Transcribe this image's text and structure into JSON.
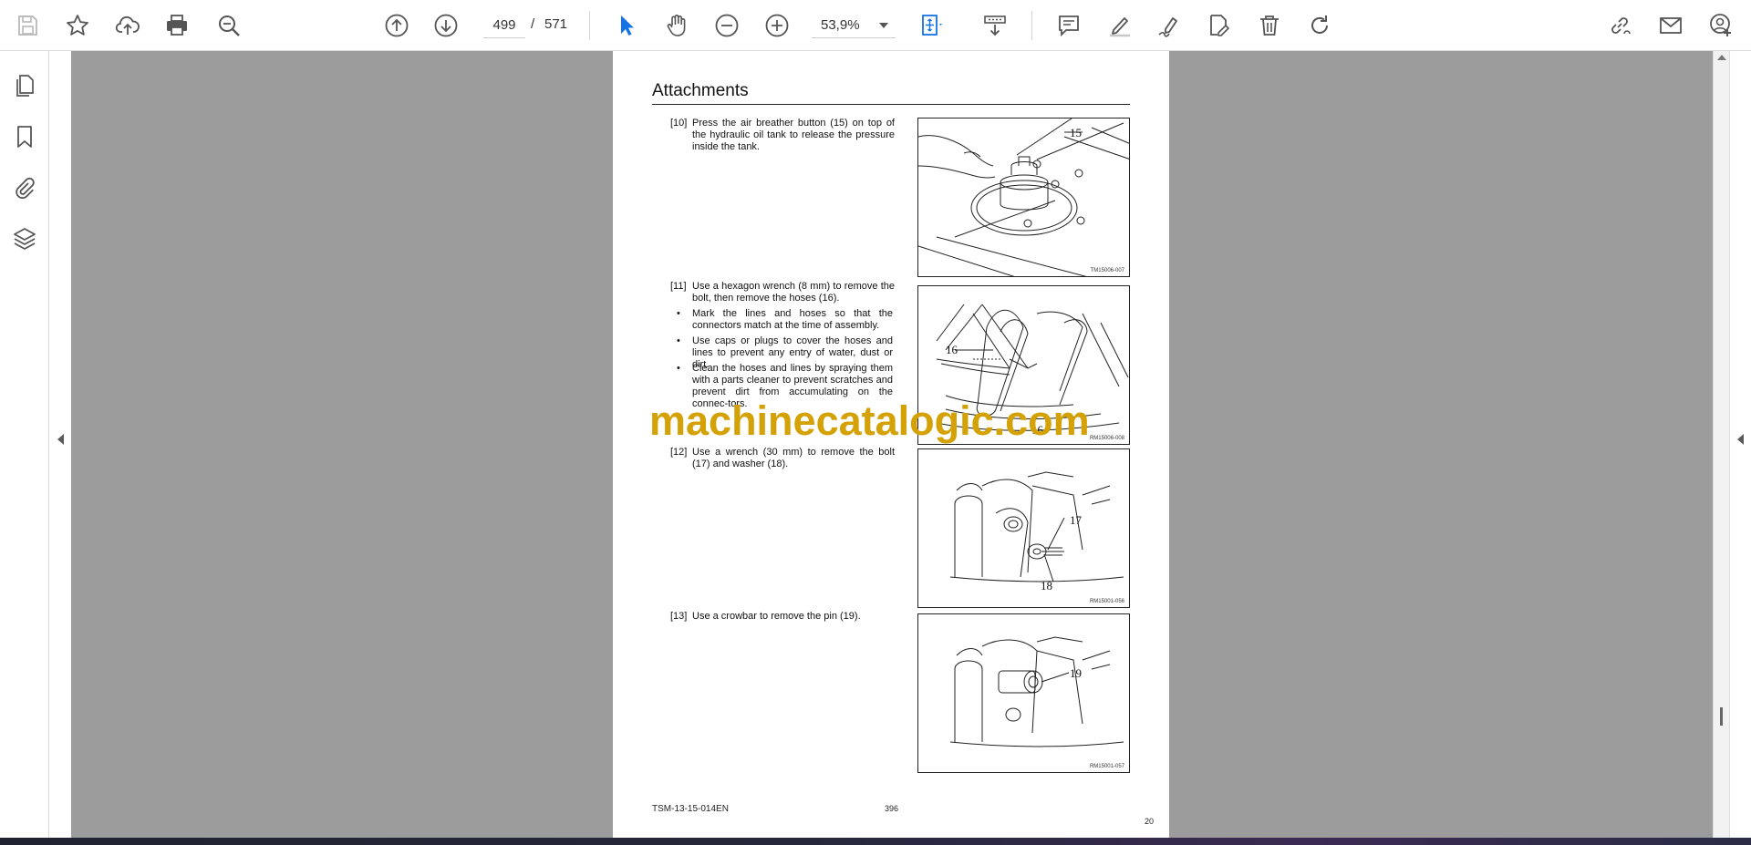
{
  "toolbar": {
    "page_current": "499",
    "page_separator": "/",
    "page_total": "571",
    "zoom": "53,9%",
    "accent_color": "#1473e6",
    "icons": [
      "save-icon",
      "bookmark-star-icon",
      "cloud-upload-icon",
      "print-icon",
      "zoom-search-icon",
      "page-up-icon",
      "page-down-icon",
      "select-cursor-icon",
      "hand-tool-icon",
      "zoom-out-icon",
      "zoom-in-icon",
      "fit-page-icon",
      "scroll-mode-icon",
      "comment-icon",
      "highlight-pen-icon",
      "sign-pen-icon",
      "edit-pdf-icon",
      "delete-icon",
      "redo-icon",
      "share-link-icon",
      "email-icon",
      "add-user-icon"
    ]
  },
  "left_panel": {
    "icons": [
      "pages-thumbnail-icon",
      "bookmark-icon",
      "attachment-icon",
      "layers-icon"
    ]
  },
  "document": {
    "title": "Attachments",
    "steps": [
      {
        "num": "[10]",
        "text": "Press the air breather button (15) on top of the hydraulic oil tank to release the pressure inside the tank."
      },
      {
        "num": "[11]",
        "text": "Use a hexagon wrench (8 mm) to remove the bolt, then remove the hoses (16)."
      },
      {
        "num": "[12]",
        "text": "Use a wrench (30 mm) to remove the bolt (17) and washer (18)."
      },
      {
        "num": "[13]",
        "text": "Use a crowbar to remove the pin (19)."
      }
    ],
    "bullets": [
      "Mark the lines and hoses so that the connectors match at the time of assembly.",
      "Use caps or plugs to cover the hoses and lines to prevent any entry of water, dust or dirt.",
      "Clean the hoses and lines by spraying them with a parts cleaner to prevent scratches and prevent dirt from accumulating on the connec-tors."
    ],
    "bullet_symbol": "•",
    "figures": [
      {
        "callouts": [
          "15"
        ],
        "code": "TM15006-007"
      },
      {
        "callouts": [
          "16",
          "16"
        ],
        "code": "RM15006-008"
      },
      {
        "callouts": [
          "17",
          "18"
        ],
        "code": "RM15001-056"
      },
      {
        "callouts": [
          "19"
        ],
        "code": "RM15001-057"
      }
    ],
    "watermark": "machinecatalogic.com",
    "footer_left": "TSM-13-15-014EN",
    "footer_mid": "396",
    "footer_right": "20"
  }
}
